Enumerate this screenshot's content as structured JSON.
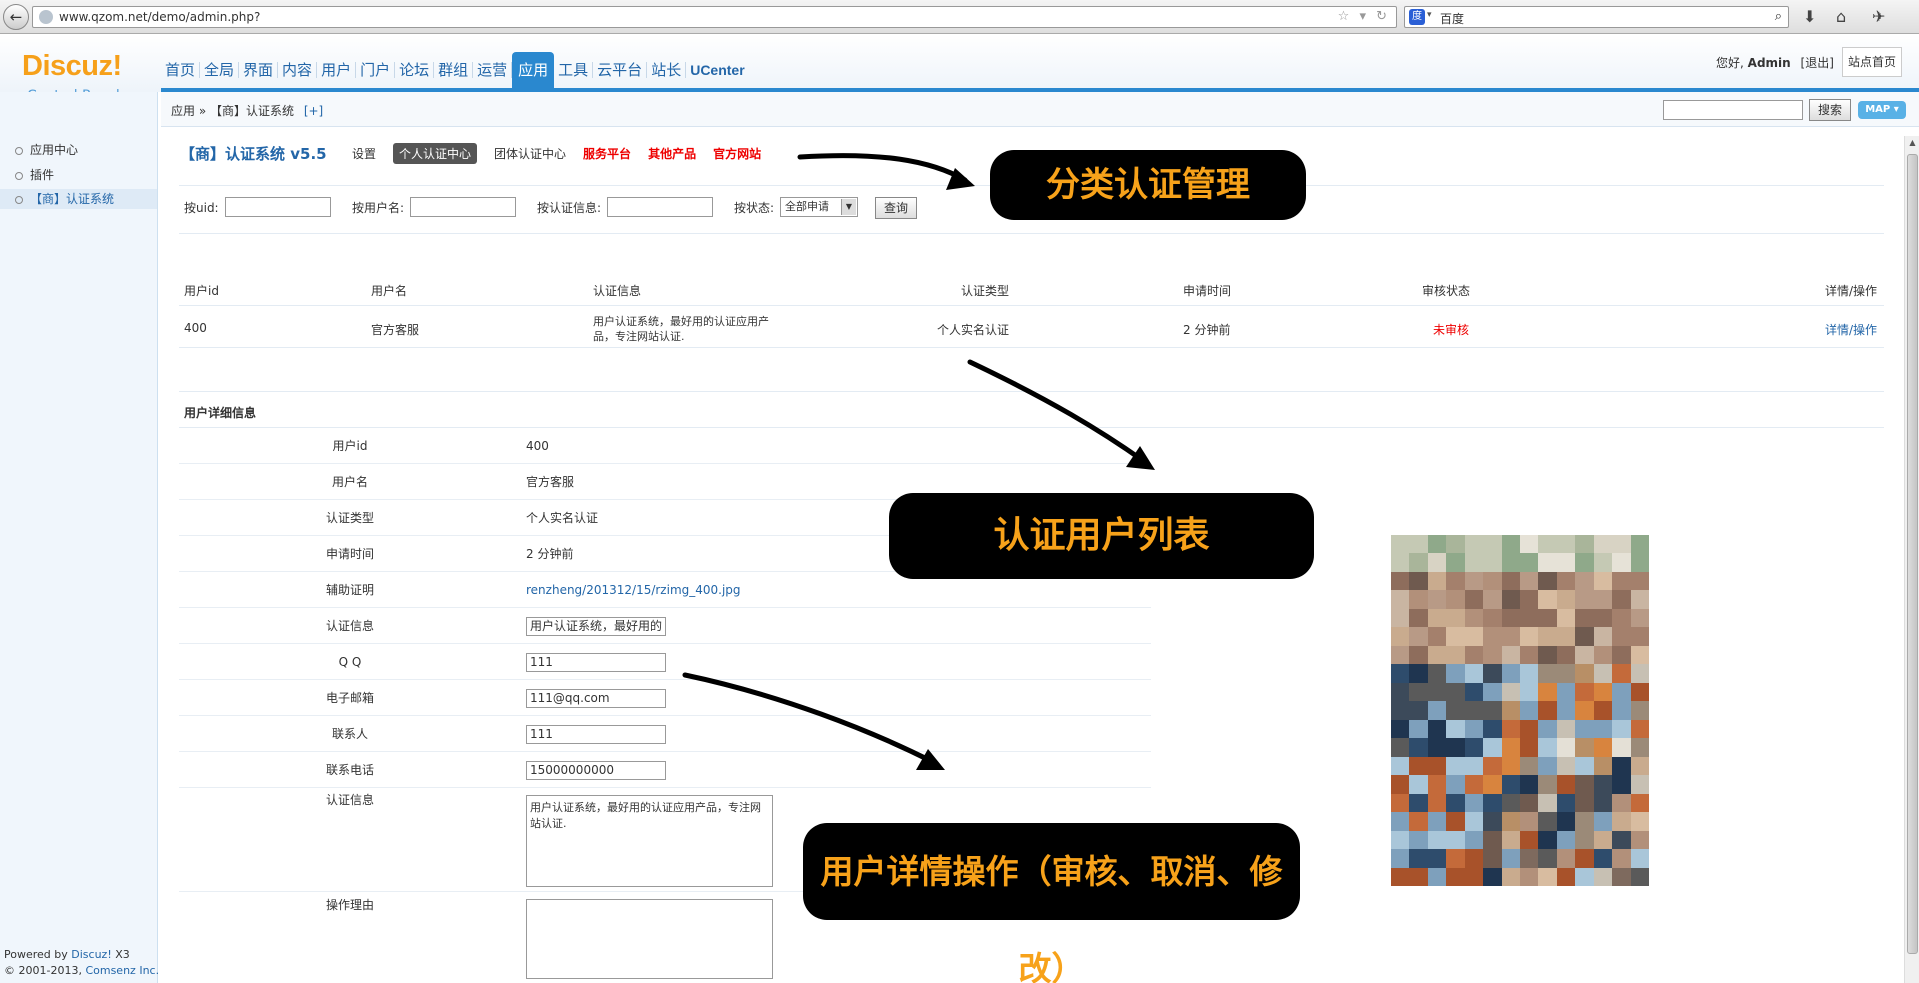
{
  "browser": {
    "url": "www.qzom.net/demo/admin.php?",
    "search_engine": "百度",
    "back_icon": "back-arrow-icon"
  },
  "header": {
    "logo": "Discuz!",
    "subtitle": "Control Panel",
    "nav": [
      "首页",
      "全局",
      "界面",
      "内容",
      "用户",
      "门户",
      "论坛",
      "群组",
      "运营",
      "应用",
      "工具",
      "云平台",
      "站长",
      "UCenter"
    ],
    "active_nav": "应用",
    "greeting_prefix": "您好,",
    "username": "Admin",
    "logout": "[退出]",
    "site_home": "站点首页",
    "brand_color": "#2a88cf",
    "logo_color": "#f6a01a"
  },
  "breadcrumb": {
    "path": "应用 » 【商】认证系统",
    "add": "[+]",
    "search_button": "搜索",
    "map_button": "MAP ▾"
  },
  "sidebar": {
    "items": [
      {
        "label": "应用中心"
      },
      {
        "label": "插件"
      },
      {
        "label": "【商】认证系统"
      }
    ],
    "powered_prefix": "Powered by",
    "powered_link": "Discuz!",
    "powered_version": "X3",
    "copyright_prefix": "© 2001-2013,",
    "copyright_link": "Comsenz Inc."
  },
  "plugin": {
    "title": "【商】认证系统 v5.5",
    "tabs": [
      {
        "label": "设置",
        "style": "normal"
      },
      {
        "label": "个人认证中心",
        "style": "active"
      },
      {
        "label": "团体认证中心",
        "style": "normal"
      },
      {
        "label": "服务平台",
        "style": "red"
      },
      {
        "label": "其他产品",
        "style": "red"
      },
      {
        "label": "官方网站",
        "style": "red"
      }
    ]
  },
  "filters": {
    "uid_label": "按uid:",
    "username_label": "按用户名:",
    "info_label": "按认证信息:",
    "status_label": "按状态:",
    "status_value": "全部申请",
    "query_button": "查询"
  },
  "table": {
    "headers": [
      "用户id",
      "用户名",
      "认证信息",
      "认证类型",
      "申请时间",
      "审核状态",
      "详情/操作"
    ],
    "rows": [
      {
        "uid": "400",
        "username": "官方客服",
        "info_line1": "用户认证系统，最好用的认证应用产",
        "info_line2": "品，专注网站认证.",
        "type": "个人实名认证",
        "time": "2 分钟前",
        "status": "未审核",
        "action": "详情/操作"
      }
    ]
  },
  "details": {
    "title": "用户详细信息",
    "rows": [
      {
        "label": "用户id",
        "value": "400"
      },
      {
        "label": "用户名",
        "value": "官方客服"
      },
      {
        "label": "认证类型",
        "value": "个人实名认证"
      },
      {
        "label": "申请时间",
        "value": "2 分钟前"
      },
      {
        "label": "辅助证明",
        "value": "renzheng/201312/15/rzimg_400.jpg"
      },
      {
        "label": "认证信息",
        "value": "用户认证系统，最好用的"
      },
      {
        "label": "Q Q",
        "value": "111"
      },
      {
        "label": "电子邮箱",
        "value": "111@qq.com"
      },
      {
        "label": "联系人",
        "value": "111"
      },
      {
        "label": "联系电话",
        "value": "15000000000"
      }
    ],
    "info_area_label": "认证信息",
    "info_area_value": "用户认证系统，最好用的认证应用产品，专注网站认证.",
    "reason_label": "操作理由",
    "reason_value": ""
  },
  "callouts": {
    "category": "分类认证管理",
    "user_list": "认证用户列表",
    "user_ops": "用户详情操作（审核、取消、修改）",
    "text_color": "#f7a21a"
  }
}
